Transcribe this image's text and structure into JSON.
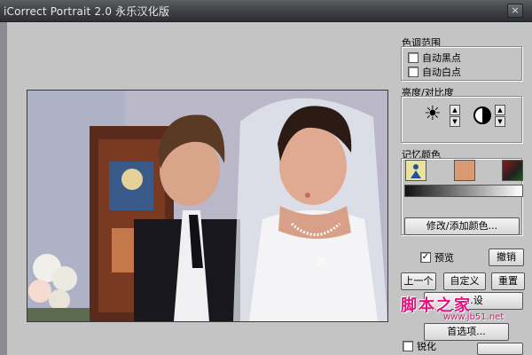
{
  "window": {
    "title": "iCorrect Portrait 2.0 永乐汉化版",
    "close_glyph": "×"
  },
  "tone_range": {
    "title": "色调范围",
    "auto_black": "自动黑点",
    "auto_white": "自动白点"
  },
  "brightness": {
    "title": "亮度/对比度",
    "brightness_icon": "sun-icon",
    "contrast_icon": "contrast-icon"
  },
  "memory_color": {
    "title": "记忆颜色",
    "modify_button": "修改/添加颜色..."
  },
  "controls": {
    "preview_label": "预览",
    "preview_checked": true,
    "undo": "撤销",
    "previous": "上一个",
    "custom": "自定义",
    "reset": "重置",
    "default_partial": "...设",
    "preferences": "首选项...",
    "sharpen": "锐化"
  },
  "watermark": {
    "text": "脚本之家",
    "url": "www.jb51.net"
  },
  "colors": {
    "titlebar": "#3d3f43",
    "panel": "#c4c4c4",
    "watermark": "#e3147e"
  }
}
